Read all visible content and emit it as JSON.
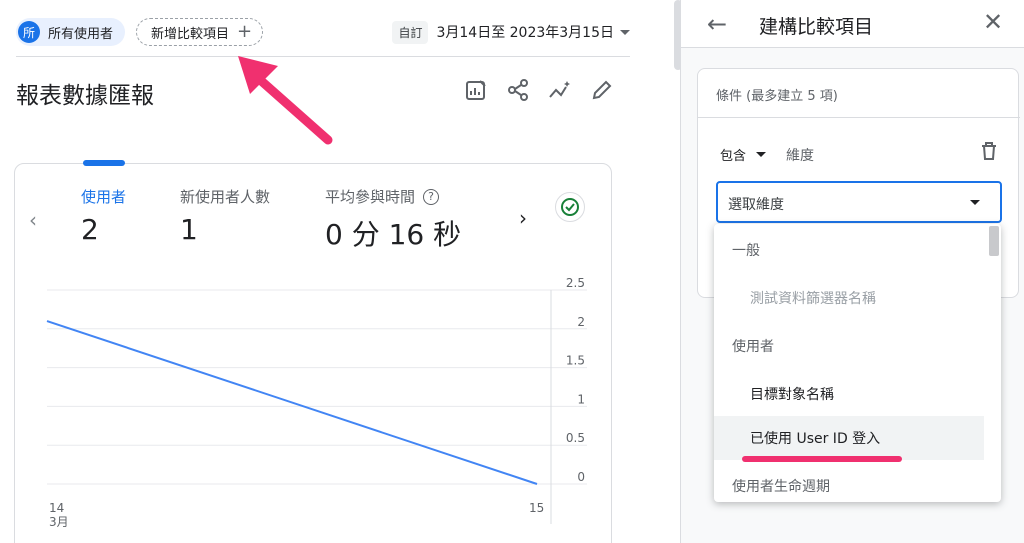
{
  "topbar": {
    "all_users_avatar": "所",
    "all_users_label": "所有使用者",
    "add_comparison_label": "新增比較項目",
    "add_icon": "+",
    "custom_badge": "自訂",
    "date_range": "3月14日至 2023年3月15日"
  },
  "report": {
    "title": "報表數據匯報"
  },
  "metrics": [
    {
      "label": "使用者",
      "value": "2"
    },
    {
      "label": "新使用者人數",
      "value": "1"
    },
    {
      "label": "平均參與時間",
      "value": "0 分 16 秒"
    }
  ],
  "help_icon": "?",
  "chart_data": {
    "type": "line",
    "x": [
      "14",
      "15"
    ],
    "x_sublabel": "3月",
    "series": [
      {
        "values": [
          2.1,
          0
        ]
      }
    ],
    "y_ticks": [
      "2.5",
      "2",
      "1.5",
      "1",
      "0.5",
      "0"
    ],
    "ylim": [
      0,
      2.5
    ],
    "line_color": "#4285f4",
    "grid": true
  },
  "panel": {
    "title": "建構比較項目",
    "conditions_title": "條件 (最多建立 5 項)",
    "include_label": "包含",
    "dimension_label": "維度",
    "select_placeholder": "選取維度"
  },
  "dropdown": {
    "items": [
      {
        "label": "一般",
        "kind": "header"
      },
      {
        "label": "測試資料篩選器名稱",
        "kind": "sub-disabled"
      },
      {
        "label": "使用者",
        "kind": "header"
      },
      {
        "label": "目標對象名稱",
        "kind": "sub"
      },
      {
        "label": "已使用 User ID 登入",
        "kind": "sub-hover"
      },
      {
        "label": "使用者生命週期",
        "kind": "header"
      }
    ]
  },
  "colors": {
    "accent": "#1a73e8",
    "annotation": "#f0306f",
    "success": "#188038"
  },
  "icons": [
    "back-arrow-icon",
    "close-icon",
    "trash-icon",
    "check-circle-icon",
    "share-icon",
    "insights-icon",
    "edit-icon",
    "customize-report-icon",
    "chevron-left-icon",
    "chevron-right-icon"
  ]
}
